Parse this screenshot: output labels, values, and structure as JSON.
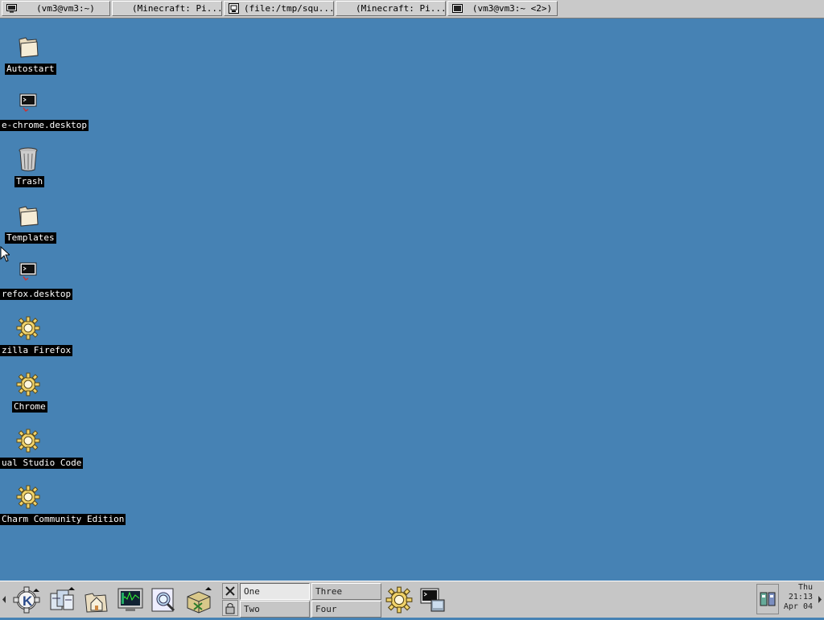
{
  "taskbar": {
    "tasks": [
      {
        "label": "(vm3@vm3:~)",
        "icon": "terminal-icon"
      },
      {
        "label": "(Minecraft: Pi...",
        "icon": "none"
      },
      {
        "label": "(file:/tmp/squ...",
        "icon": "file-manager-icon"
      },
      {
        "label": "(Minecraft: Pi...",
        "icon": "none"
      },
      {
        "label": "(vm3@vm3:~ <2>)",
        "icon": "terminal-icon"
      }
    ]
  },
  "desktop": {
    "background_color": "#4682b4",
    "icons": [
      {
        "label": "Autostart",
        "icon": "folder-icon"
      },
      {
        "label": "e-chrome.desktop",
        "icon": "terminal-icon"
      },
      {
        "label": "Trash",
        "icon": "trash-icon"
      },
      {
        "label": "Templates",
        "icon": "folder-icon"
      },
      {
        "label": "refox.desktop",
        "icon": "terminal-icon"
      },
      {
        "label": "zilla Firefox",
        "icon": "gear-icon"
      },
      {
        "label": "Chrome",
        "icon": "gear-icon"
      },
      {
        "label": "ual Studio Code",
        "icon": "gear-icon"
      },
      {
        "label": "Charm Community Edition",
        "icon": "gear-icon"
      }
    ]
  },
  "panel": {
    "launchers": [
      {
        "name": "kde-menu-icon"
      },
      {
        "name": "window-list-icon"
      },
      {
        "name": "home-folder-icon"
      },
      {
        "name": "system-monitor-icon"
      },
      {
        "name": "find-files-icon"
      },
      {
        "name": "package-icon"
      }
    ],
    "desktops": [
      {
        "label": "One",
        "active": true
      },
      {
        "label": "Three",
        "active": false
      },
      {
        "label": "Two",
        "active": false
      },
      {
        "label": "Four",
        "active": false
      }
    ],
    "tray": [
      {
        "name": "settings-gear-icon"
      },
      {
        "name": "terminal-icon"
      }
    ],
    "clock": {
      "day": "Thu",
      "time": "21:13",
      "date": "Apr 04"
    }
  }
}
